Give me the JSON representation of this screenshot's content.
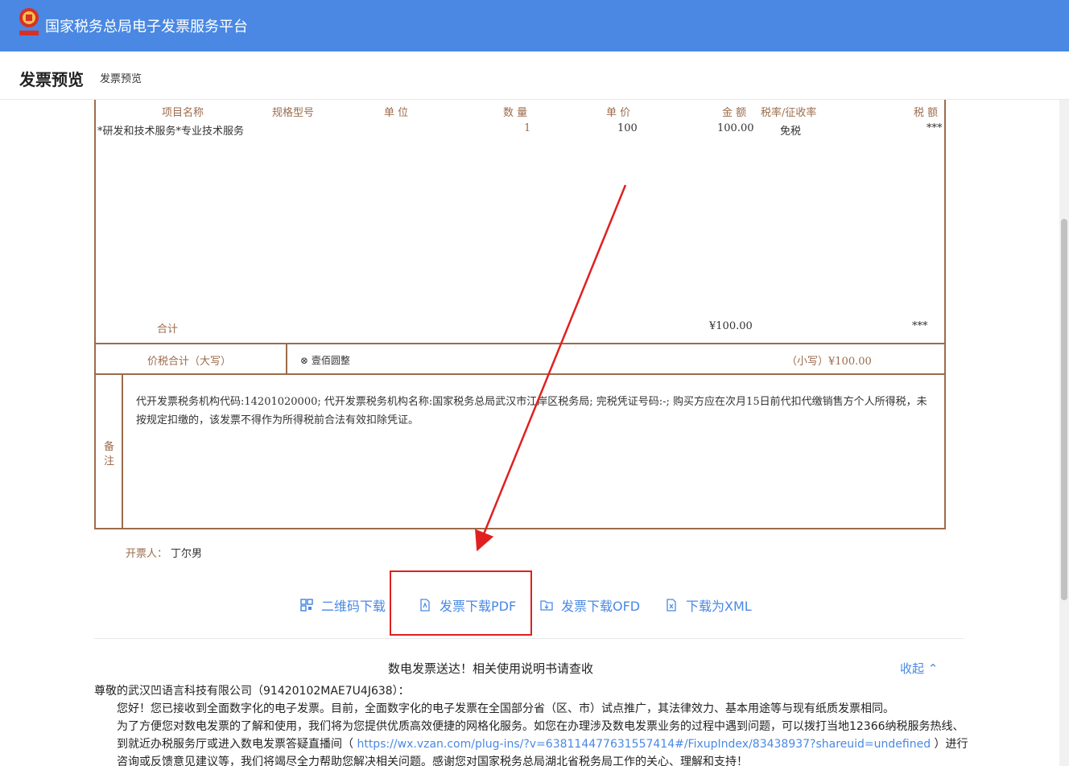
{
  "header": {
    "title": "国家税务总局电子发票服务平台",
    "logo_text": "中国税务"
  },
  "subbar": {
    "title": "发票预览",
    "breadcrumb": "发票预览"
  },
  "invoice": {
    "columns": {
      "item_name": "项目名称",
      "spec": "规格型号",
      "unit": "单 位",
      "qty": "数 量",
      "price": "单 价",
      "amount": "金 额",
      "tax_rate": "税率/征收率",
      "tax": "税 额"
    },
    "row": {
      "item_name": "*研发和技术服务*专业技术服务",
      "qty": "1",
      "price": "100",
      "amount": "100.00",
      "tax_rate": "免税",
      "tax": "***"
    },
    "total_label": "合计",
    "total_amount": "¥100.00",
    "total_tax": "***",
    "grand_total_label": "价税合计（大写）",
    "grand_total_upper": "壹佰圆整",
    "grand_total_small": "（小写）¥100.00",
    "remark_label_1": "备",
    "remark_label_2": "注",
    "remark_text": "代开发票税务机构代码:14201020000; 代开发票税务机构名称:国家税务总局武汉市江岸区税务局; 完税凭证号码:-; 购买方应在次月15日前代扣代缴销售方个人所得税，未按规定扣缴的，该发票不得作为所得税前合法有效扣除凭证。",
    "issuer_label": "开票人：",
    "issuer_name": "丁尔男"
  },
  "actions": {
    "qr": "二维码下载",
    "pdf": "发票下载PDF",
    "ofd": "发票下载OFD",
    "xml": "下载为XML"
  },
  "notice": {
    "title": "数电发票送达！相关使用说明书请查收",
    "collapse": "收起",
    "greeting": "尊敬的武汉凹语言科技有限公司（91420102MAE7U4J638）：",
    "p1": "您好！您已接收到全面数字化的电子发票。目前，全面数字化的电子发票在全国部分省（区、市）试点推广，其法律效力、基本用途等与现有纸质发票相同。",
    "p2a": "为了方便您对数电发票的了解和使用，我们将为您提供优质高效便捷的网格化服务。如您在办理涉及数电发票业务的过程中遇到问题，可以拨打当地12366纳税服务热线、到就近办税服务厅或进入数电发票答疑直播间（ ",
    "link": "https://wx.vzan.com/plug-ins/?v=638114477631557414#/FixupIndex/83438937?shareuid=undefined",
    "p2b": " ）进行咨询或反馈意见建议等，我们将竭尽全力帮助您解决相关问题。感谢您对国家税务总局湖北省税务局工作的关心、理解和支持！"
  },
  "colors": {
    "brand_blue": "#4a88e3",
    "invoice_brown": "#9c6b4b",
    "highlight_red": "#e02020"
  }
}
